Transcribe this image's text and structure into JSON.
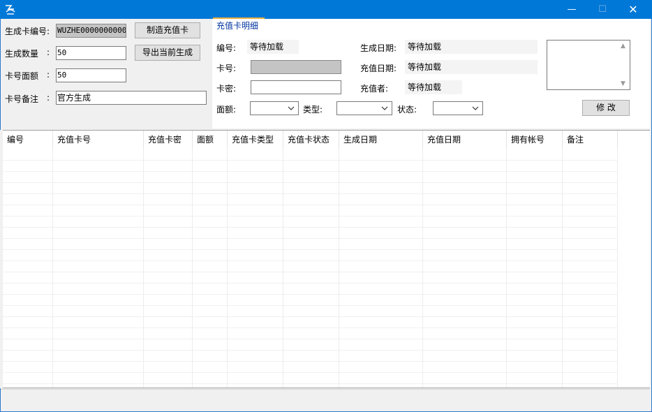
{
  "window": {
    "app_icon": "app-logo-icon",
    "minimize_glyph": "—",
    "maximize_glyph": "☐",
    "close_glyph": "✕"
  },
  "generate": {
    "card_no_label": "生成卡编号:",
    "card_no_value": "WUZHE0000000000",
    "quantity_label": "生成数量",
    "quantity_value": "50",
    "face_value_label": "卡号面额",
    "face_value_value": "50",
    "note_label": "卡号备注",
    "note_value": "官方生成",
    "colon": ":",
    "create_button": "制造充值卡",
    "export_button": "导出当前生成"
  },
  "detail": {
    "tab_label": "充值卡明细",
    "id_label": "编号:",
    "id_value": "等待加载",
    "card_label": "卡号:",
    "password_label": "卡密:",
    "face_label": "面额:",
    "type_label": "类型:",
    "status_label": "状态:",
    "gen_date_label": "生成日期:",
    "gen_date_value": "等待加载",
    "charge_date_label": "充值日期:",
    "charge_date_value": "等待加载",
    "charger_label": "充值者:",
    "charger_value": "等待加载",
    "modify_button": "修 改"
  },
  "table": {
    "columns": [
      "编号",
      "充值卡号",
      "充值卡密",
      "面额",
      "充值卡类型",
      "充值卡状态",
      "生成日期",
      "充值日期",
      "拥有帐号",
      "备注"
    ],
    "rows": []
  }
}
